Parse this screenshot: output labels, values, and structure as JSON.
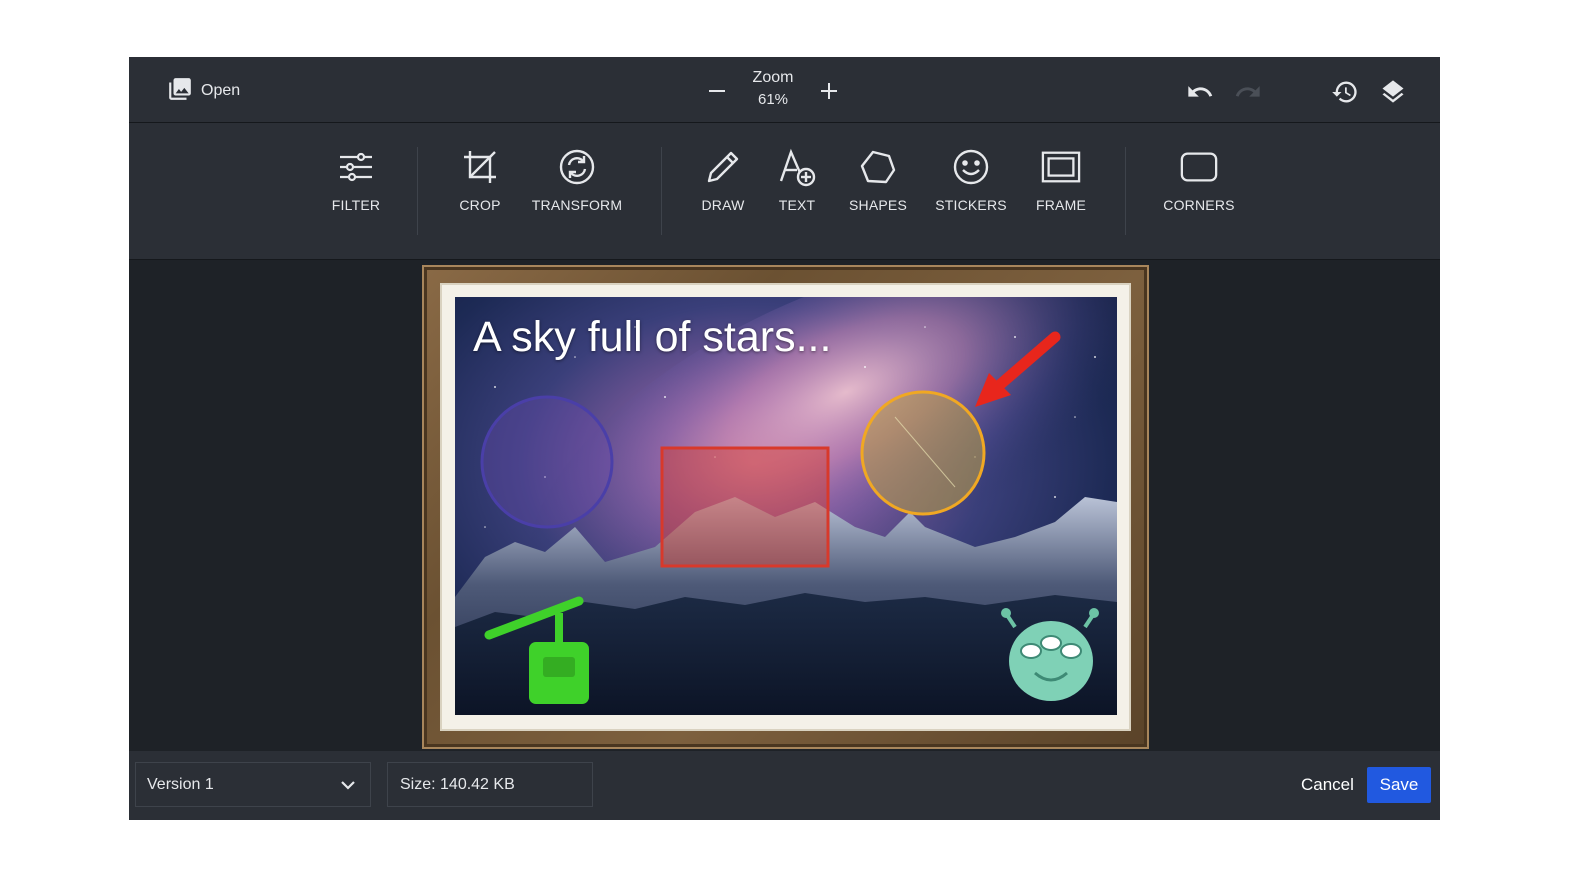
{
  "topbar": {
    "open_label": "Open",
    "zoom_label": "Zoom",
    "zoom_value": "61%"
  },
  "tools": [
    {
      "label": "FILTER",
      "icon": "sliders-icon"
    },
    {
      "label": "CROP",
      "icon": "crop-icon"
    },
    {
      "label": "TRANSFORM",
      "icon": "rotate-icon"
    },
    {
      "label": "DRAW",
      "icon": "pencil-icon"
    },
    {
      "label": "TEXT",
      "icon": "text-add-icon"
    },
    {
      "label": "SHAPES",
      "icon": "shapes-icon"
    },
    {
      "label": "STICKERS",
      "icon": "smiley-icon"
    },
    {
      "label": "FRAME",
      "icon": "frame-icon"
    },
    {
      "label": "CORNERS",
      "icon": "rounded-rect-icon"
    }
  ],
  "canvas": {
    "text": "A sky full of stars...",
    "colors": {
      "circle_purple": "#4a3fa8",
      "rect_red": "#d8392b",
      "circle_yellow": "#f0a823",
      "arrow_red": "#e8261c",
      "sticker_green": "#3fd12a",
      "alien_teal": "#7fd1b6"
    }
  },
  "bottombar": {
    "version_value": "Version 1",
    "size_text": "Size: 140.42 KB",
    "cancel_label": "Cancel",
    "save_label": "Save"
  },
  "colors": {
    "panel": "#2b2f36",
    "background": "#1e2227",
    "accent": "#2159e0",
    "text": "#e6e8eb"
  }
}
